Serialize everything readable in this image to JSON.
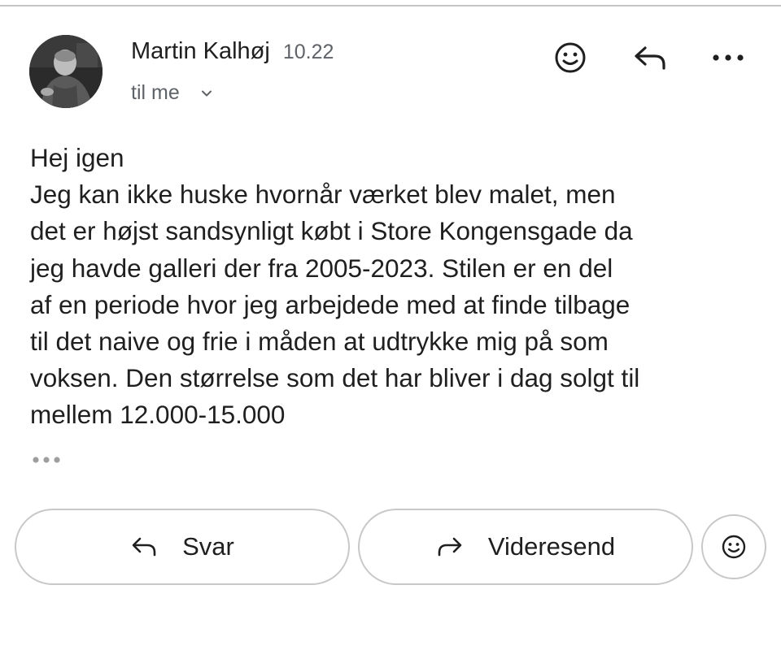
{
  "message": {
    "sender_name": "Martin Kalhøj",
    "time": "10.22",
    "recipient": "til me",
    "body_lines": [
      "Hej igen",
      "Jeg kan ikke huske hvornår værket blev malet, men",
      "det er højst sandsynligt købt i Store Kongensgade da",
      "jeg havde galleri der fra 2005-2023. Stilen er en del",
      "af en periode hvor jeg arbejdede med at finde tilbage",
      "til det naive og frie i måden at udtrykke mig på som",
      "voksen. Den størrelse som det har bliver i dag solgt til",
      "mellem 12.000-15.000"
    ]
  },
  "header_actions": {
    "emoji_icon": "smiley-face-icon",
    "reply_icon": "reply-arrow-icon",
    "more_icon": "more-horizontal-icon"
  },
  "footer_actions": {
    "reply_label": "Svar",
    "forward_label": "Videresend",
    "emoji_icon": "smiley-face-icon"
  },
  "colors": {
    "text": "#1f1f1f",
    "secondary_text": "#5f6368",
    "border": "#c8c8c8",
    "ellipsis": "#9e9e9e"
  }
}
